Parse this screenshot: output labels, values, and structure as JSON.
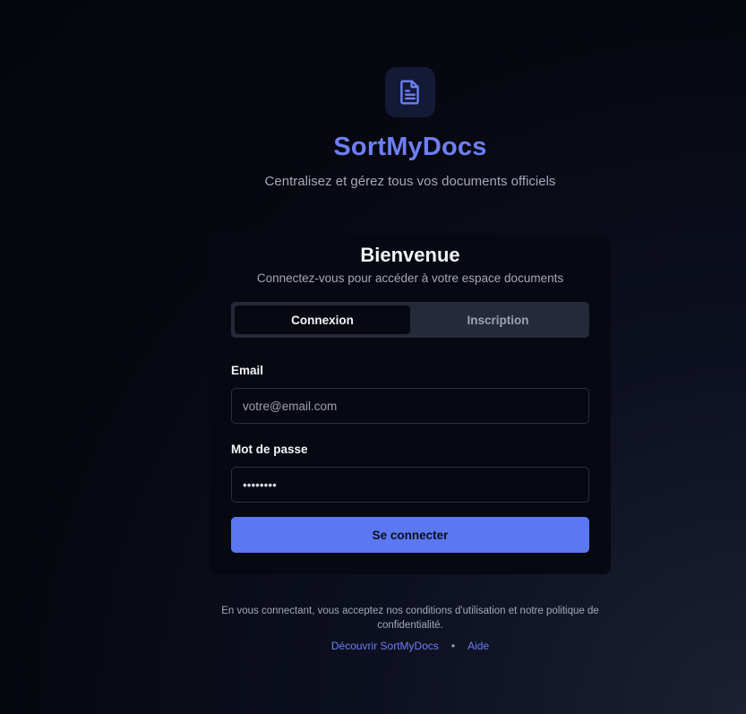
{
  "brand": {
    "name": "SortMyDocs",
    "tagline": "Centralisez et gérez tous vos documents officiels",
    "logo_icon": "document-icon",
    "accent_color": "#6d7ff2"
  },
  "card": {
    "title": "Bienvenue",
    "subtitle": "Connectez-vous pour accéder à votre espace documents",
    "tabs": [
      {
        "label": "Connexion",
        "active": true
      },
      {
        "label": "Inscription",
        "active": false
      }
    ],
    "email": {
      "label": "Email",
      "placeholder": "votre@email.com",
      "value": ""
    },
    "password": {
      "label": "Mot de passe",
      "value": "••••••••"
    },
    "submit_label": "Se connecter",
    "button_color": "#5b78f0"
  },
  "footer": {
    "terms": "En vous connectant, vous acceptez nos conditions d'utilisation et notre politique de confidentialité.",
    "links": [
      {
        "label": "Découvrir SortMyDocs"
      },
      {
        "label": "Aide"
      }
    ],
    "separator": "•"
  }
}
